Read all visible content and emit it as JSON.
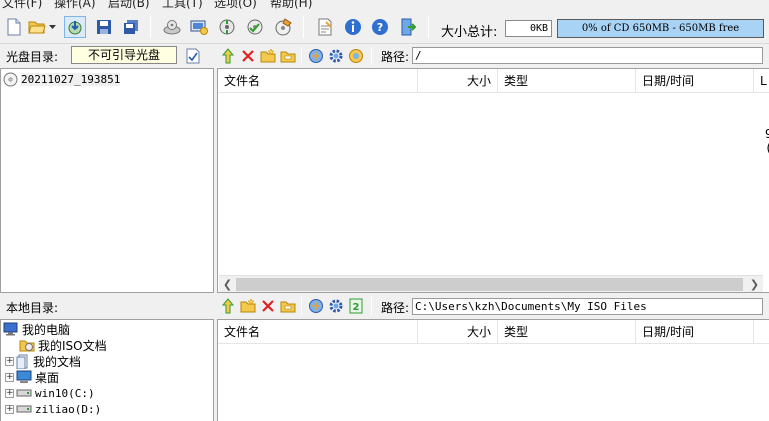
{
  "menu": {
    "items": [
      "文件(F)",
      "操作(A)",
      "启动(B)",
      "工具(T)",
      "选项(O)",
      "帮助(H)"
    ]
  },
  "toolbar": {
    "size_label": "大小总计:",
    "size_value": "0KB",
    "capacity_text": "0% of CD 650MB - 650MB free",
    "capacity_fill": 0,
    "icons": [
      "new-icon",
      "open-icon",
      "dropdown-arrow-icon",
      "extract-icon",
      "save-icon",
      "save-as-icon",
      "burn-icon",
      "mount-icon",
      "compress-icon",
      "verify-icon",
      "create-cd-icon",
      "properties-icon",
      "info-icon",
      "help-icon",
      "exit-icon"
    ]
  },
  "disc_pane": {
    "label": "光盘目录:",
    "disc_type": "不可引导光盘",
    "path_label": "路径:",
    "path_value": "/",
    "root_item": "20211027_193851",
    "columns": [
      "文件名",
      "大小",
      "类型",
      "日期/时间",
      "L"
    ]
  },
  "local_pane": {
    "label": "本地目录:",
    "path_label": "路径:",
    "path_value": "C:\\Users\\kzh\\Documents\\My ISO Files",
    "columns": [
      "文件名",
      "大小",
      "类型",
      "日期/时间"
    ],
    "tree": [
      {
        "label": "我的电脑",
        "icon": "computer-icon"
      },
      {
        "label": "我的ISO文档",
        "icon": "iso-folder-icon"
      },
      {
        "label": "我的文档",
        "icon": "documents-icon"
      },
      {
        "label": "桌面",
        "icon": "desktop-icon"
      },
      {
        "label": "win10(C:)",
        "icon": "drive-icon"
      },
      {
        "label": "ziliao(D:)",
        "icon": "drive-icon"
      }
    ]
  },
  "clipped_text": [
    "9",
    "("
  ],
  "colors": {
    "background": "#f0f0f0",
    "capacity_bar": "#a8d3f5",
    "disc_type_bg": "#ffffe1",
    "accent_blue": "#1e5fb4",
    "accent_red": "#e02020",
    "accent_green": "#2e9e2e"
  }
}
